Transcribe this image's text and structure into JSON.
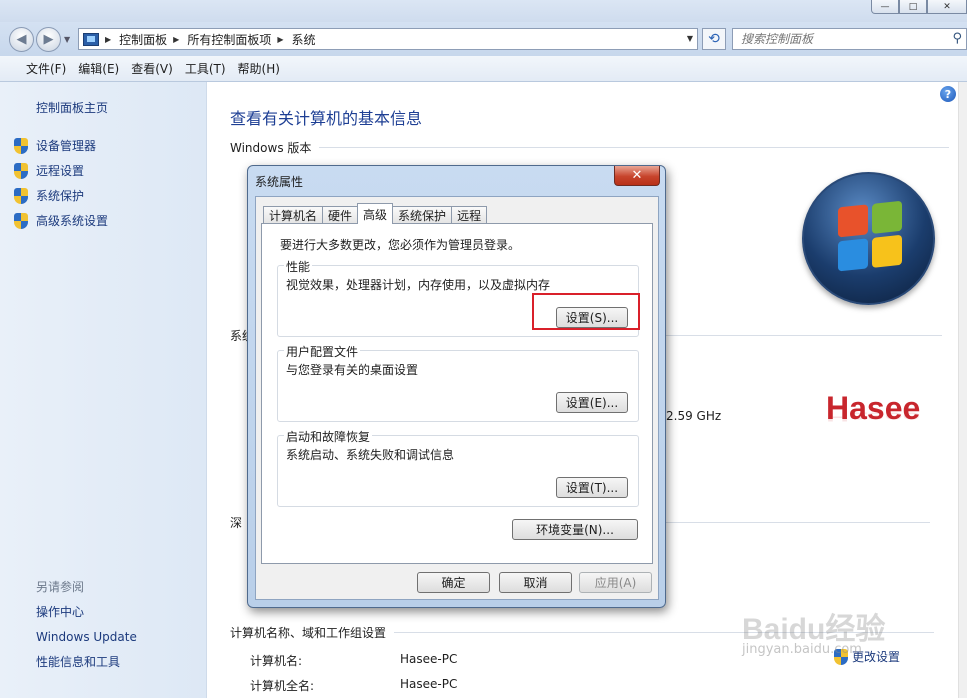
{
  "window": {
    "minimize_glyph": "—",
    "maximize_glyph": "□",
    "close_glyph": "✕"
  },
  "address": {
    "crumbs": [
      "控制面板",
      "所有控制面板项",
      "系统"
    ],
    "search_placeholder": "搜索控制面板"
  },
  "menu": [
    "文件(F)",
    "编辑(E)",
    "查看(V)",
    "工具(T)",
    "帮助(H)"
  ],
  "sidebar": {
    "home": "控制面板主页",
    "items": [
      {
        "label": "设备管理器",
        "icon": "uac-shield-icon"
      },
      {
        "label": "远程设置",
        "icon": "uac-shield-icon"
      },
      {
        "label": "系统保护",
        "icon": "uac-shield-icon"
      },
      {
        "label": "高级系统设置",
        "icon": "uac-shield-icon"
      }
    ],
    "see_also_title": "另请参阅",
    "see_also": [
      "操作中心",
      "Windows Update",
      "性能信息和工具"
    ]
  },
  "main": {
    "title": "查看有关计算机的基本信息",
    "section_edition": "Windows 版本",
    "section_system_partial": "系统",
    "section_depth_partial": "深",
    "clock_speed": "2.59 GHz",
    "brand_logo_text": "Hasee",
    "section_computer": "计算机名称、域和工作组设置",
    "computer_name_label": "计算机名:",
    "computer_name_value": "Hasee-PC",
    "computer_fullname_label": "计算机全名:",
    "computer_fullname_value": "Hasee-PC",
    "change_settings": "更改设置"
  },
  "dialog": {
    "title": "系统属性",
    "tabs": [
      "计算机名",
      "硬件",
      "高级",
      "系统保护",
      "远程"
    ],
    "active_tab": "高级",
    "admin_note": "要进行大多数更改，您必须作为管理员登录。",
    "performance": {
      "label": "性能",
      "desc": "视觉效果，处理器计划，内存使用，以及虚拟内存",
      "button": "设置(S)..."
    },
    "profiles": {
      "label": "用户配置文件",
      "desc": "与您登录有关的桌面设置",
      "button": "设置(E)..."
    },
    "startup": {
      "label": "启动和故障恢复",
      "desc": "系统启动、系统失败和调试信息",
      "button": "设置(T)..."
    },
    "env_button": "环境变量(N)...",
    "ok": "确定",
    "cancel": "取消",
    "apply": "应用(A)"
  },
  "watermark": {
    "brand": "Baidu经验",
    "url": "jingyan.baidu.com"
  },
  "colors": {
    "link": "#1c3a7d",
    "title": "#1e3f94",
    "highlight": "#d9202a",
    "hasee": "#c8262d"
  }
}
